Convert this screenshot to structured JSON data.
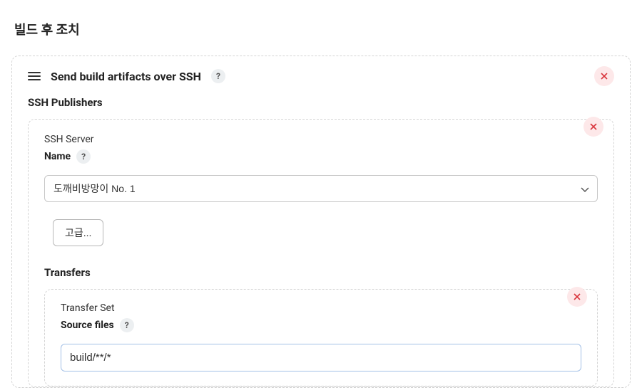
{
  "page": {
    "title": "빌드 후 조치"
  },
  "step": {
    "title": "Send build artifacts over SSH"
  },
  "publishers": {
    "label": "SSH Publishers"
  },
  "server": {
    "group_title": "SSH Server",
    "name_label": "Name",
    "selected_option": "도깨비방망이 No. 1",
    "advanced_label": "고급..."
  },
  "transfers": {
    "label": "Transfers",
    "set_title": "Transfer Set",
    "source_files_label": "Source files",
    "source_files_value": "build/**/*"
  },
  "icons": {
    "help": "?",
    "close_color": "#d9363e"
  }
}
